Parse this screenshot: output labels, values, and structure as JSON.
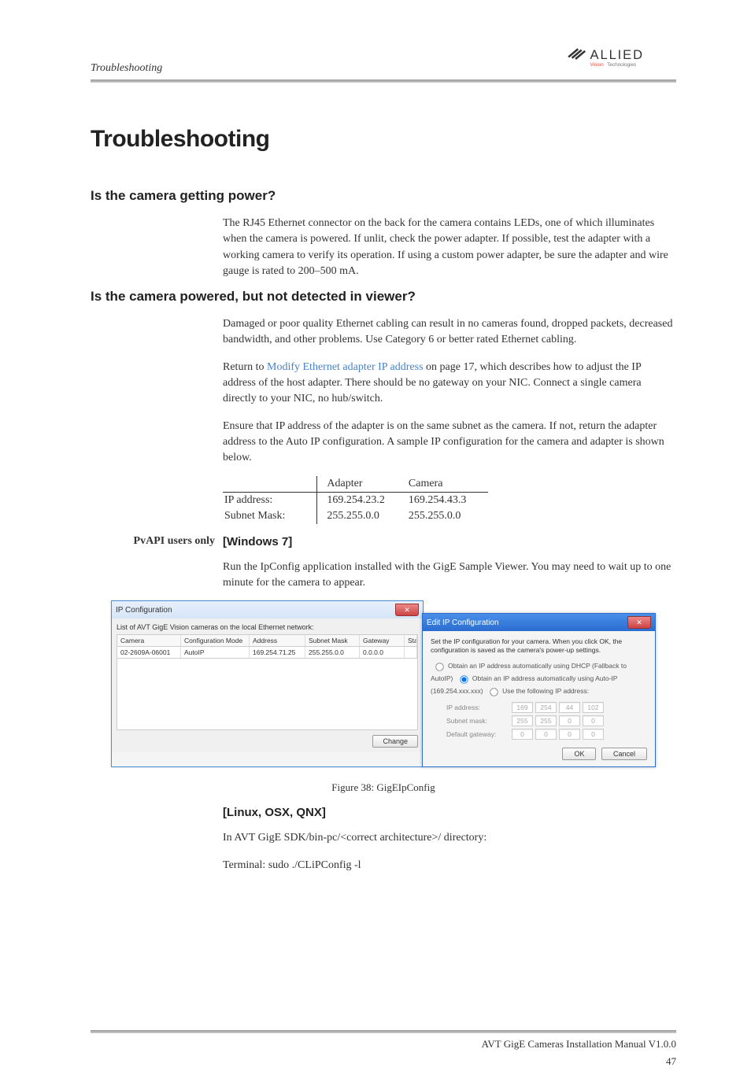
{
  "header": {
    "section": "Troubleshooting"
  },
  "logo": {
    "line1": "ALLIED",
    "line2": "Vision Technologies"
  },
  "title": "Troubleshooting",
  "s1": {
    "heading": "Is the camera getting power?",
    "p1": "The RJ45 Ethernet connector on the back for the camera contains LEDs, one of which illuminates when the camera is powered. If unlit, check the power adapter. If possible, test the adapter with a working camera to verify its opera­tion. If using a custom power adapter, be sure the adapter and wire gauge is rated to 200–500 mA."
  },
  "s2": {
    "heading": "Is the camera powered, but not detected in viewer?",
    "p1": "Damaged or poor quality Ethernet cabling can result in no cameras found, dropped packets, decreased bandwidth, and other problems. Use Category 6 or better rated Ethernet cabling.",
    "p2a": "Return to ",
    "p2link": "Modify Ethernet adapter IP address",
    "p2b": " on page 17, which describes how to adjust the IP address of the host adapter. There should be no gateway on your NIC. Connect a single camera directly to your NIC, no hub/switch.",
    "p3": "Ensure that IP address of the adapter is on the same subnet as the camera. If not, return the adapter address to the Auto IP configuration. A sample IP con­figuration for the camera and adapter is shown below.",
    "table": {
      "h1": "",
      "h2": "Adapter",
      "h3": "Camera",
      "r1c1": "IP address:",
      "r1c2": "169.254.23.2",
      "r1c3": "169.254.43.3",
      "r2c1": "Subnet Mask:",
      "r2c2": "255.255.0.0",
      "r2c3": "255.255.0.0"
    }
  },
  "pvapi": {
    "margin_label": "PvAPI users only",
    "win_heading": "[Windows 7]",
    "win_p": "Run the IpConfig application installed with the GigE Sample Viewer. You may need to wait up to one minute for the camera to appear.",
    "linux_heading": "[Linux, OSX, QNX]",
    "linux_p1": "In AVT GigE SDK/bin-pc/<correct architecture>/ directory:",
    "linux_p2": "Terminal: sudo ./CLiPConfig -l"
  },
  "ipconfig": {
    "title": "IP Configuration",
    "subtitle": "List of AVT GigE Vision cameras on the local Ethernet network:",
    "cols": {
      "c1": "Camera",
      "c2": "Configuration Mode",
      "c3": "Address",
      "c4": "Subnet Mask",
      "c5": "Gateway",
      "c6": "Status"
    },
    "row": {
      "c1": "02-2609A-06001",
      "c2": "AutoIP",
      "c3": "169.254.71.25",
      "c4": "255.255.0.0",
      "c5": "0.0.0.0",
      "c6": ""
    },
    "change": "Change"
  },
  "editip": {
    "title": "Edit IP Configuration",
    "desc": "Set the IP configuration for your camera.  When you click OK, the configuration is saved as the camera's power-up settings.",
    "r1": "Obtain an IP address automatically using DHCP (Fallback to AutoIP)",
    "r2": "Obtain an IP address automatically using Auto-IP (169.254.xxx.xxx)",
    "r3": "Use the following IP address:",
    "ip_label": "IP address:",
    "ip": [
      "169",
      "254",
      "44",
      "102"
    ],
    "sm_label": "Subnet mask:",
    "sm": [
      "255",
      "255",
      "0",
      "0"
    ],
    "gw_label": "Default gateway:",
    "gw": [
      "0",
      "0",
      "0",
      "0"
    ],
    "ok": "OK",
    "cancel": "Cancel"
  },
  "figure_caption": "Figure 38: GigEIpConfig",
  "footer": "AVT GigE Cameras Installation Manual V1.0.0",
  "page_num": "47",
  "chart_data": null
}
